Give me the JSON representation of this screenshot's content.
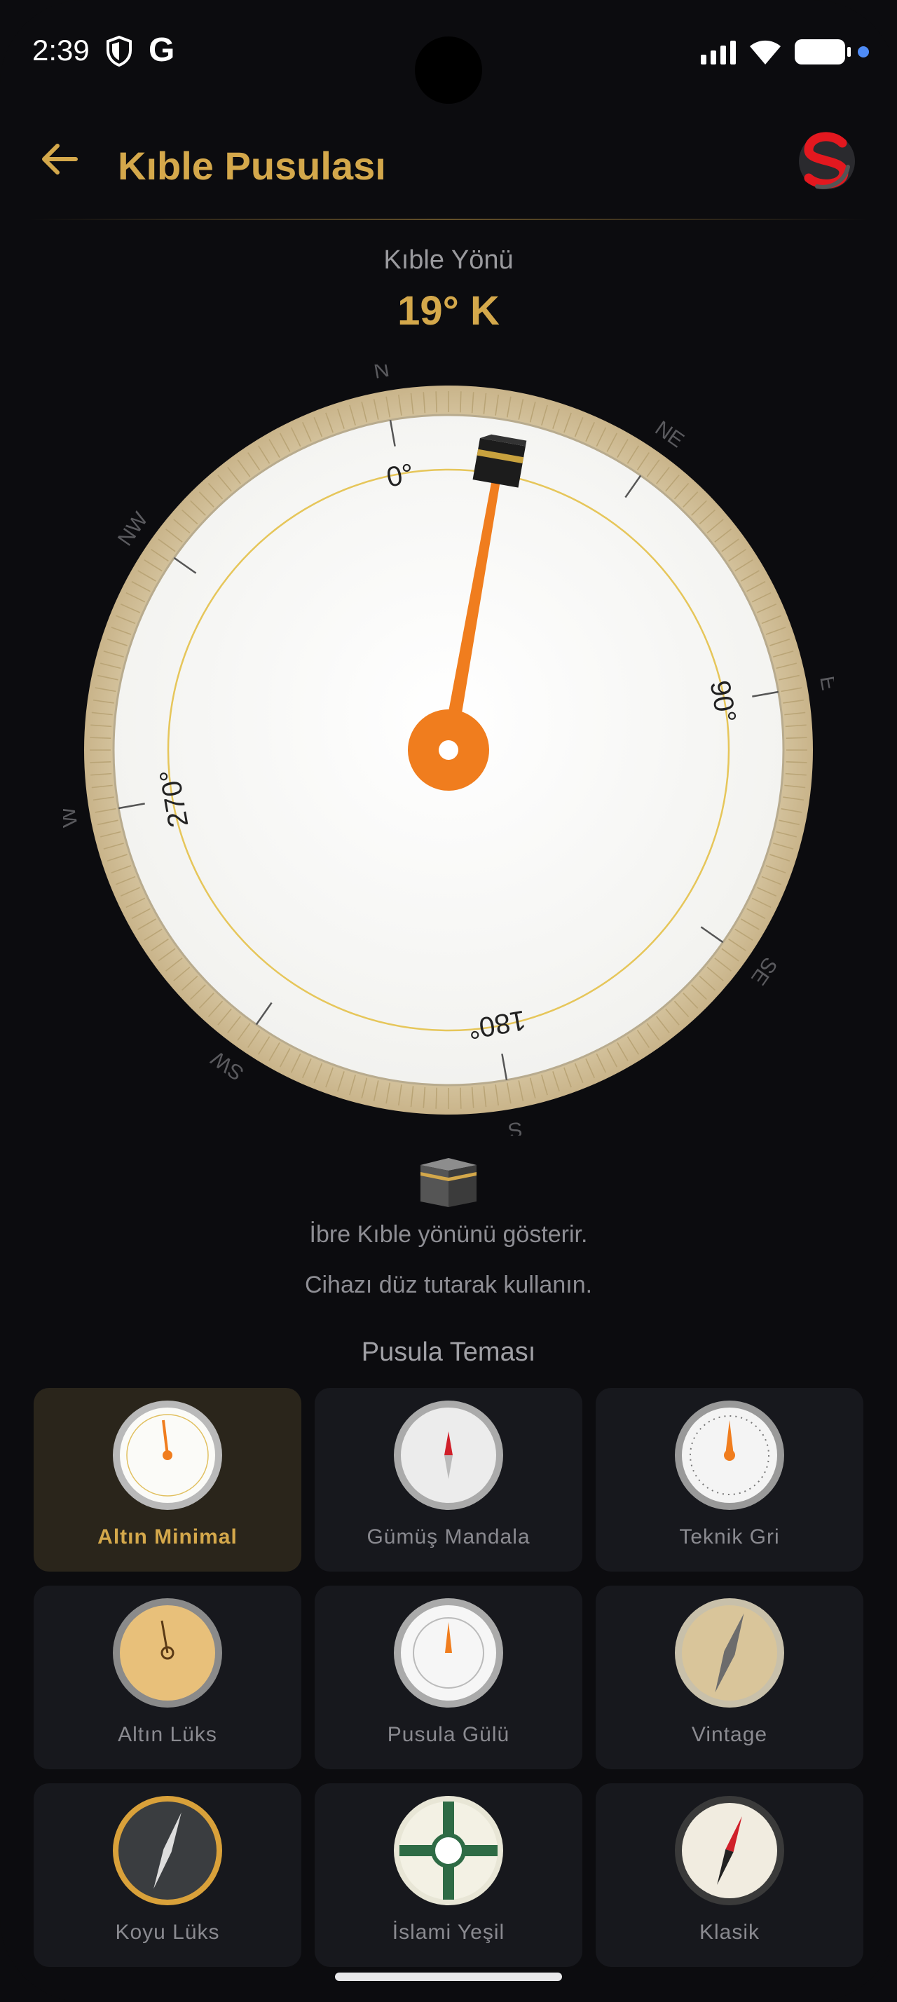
{
  "status_bar": {
    "time": "2:39",
    "g_label": "G"
  },
  "header": {
    "title": "Kıble Pusulası"
  },
  "qibla": {
    "label": "Kıble Yönü",
    "value": "19° K",
    "bearing_deg": 19
  },
  "compass": {
    "directions": [
      "N",
      "NE",
      "E",
      "SE",
      "S",
      "SW",
      "W",
      "NW"
    ],
    "degree_labels": [
      "0°",
      "90°",
      "180°",
      "270°"
    ]
  },
  "hints": [
    "İbre Kıble yönünü gösterir.",
    "Cihazı düz tutarak kullanın."
  ],
  "themes": {
    "heading": "Pusula Teması",
    "items": [
      {
        "label": "Altın Minimal",
        "selected": true
      },
      {
        "label": "Gümüş Mandala",
        "selected": false
      },
      {
        "label": "Teknik Gri",
        "selected": false
      },
      {
        "label": "Altın Lüks",
        "selected": false
      },
      {
        "label": "Pusula Gülü",
        "selected": false
      },
      {
        "label": "Vintage",
        "selected": false
      },
      {
        "label": "Koyu Lüks",
        "selected": false
      },
      {
        "label": "İslami Yeşil",
        "selected": false
      },
      {
        "label": "Klasik",
        "selected": false
      }
    ]
  },
  "colors": {
    "accent": "#d4a84b",
    "needle": "#f07d1e",
    "background": "#0c0c0f",
    "card": "#17181d",
    "card_selected": "#2a251b"
  }
}
